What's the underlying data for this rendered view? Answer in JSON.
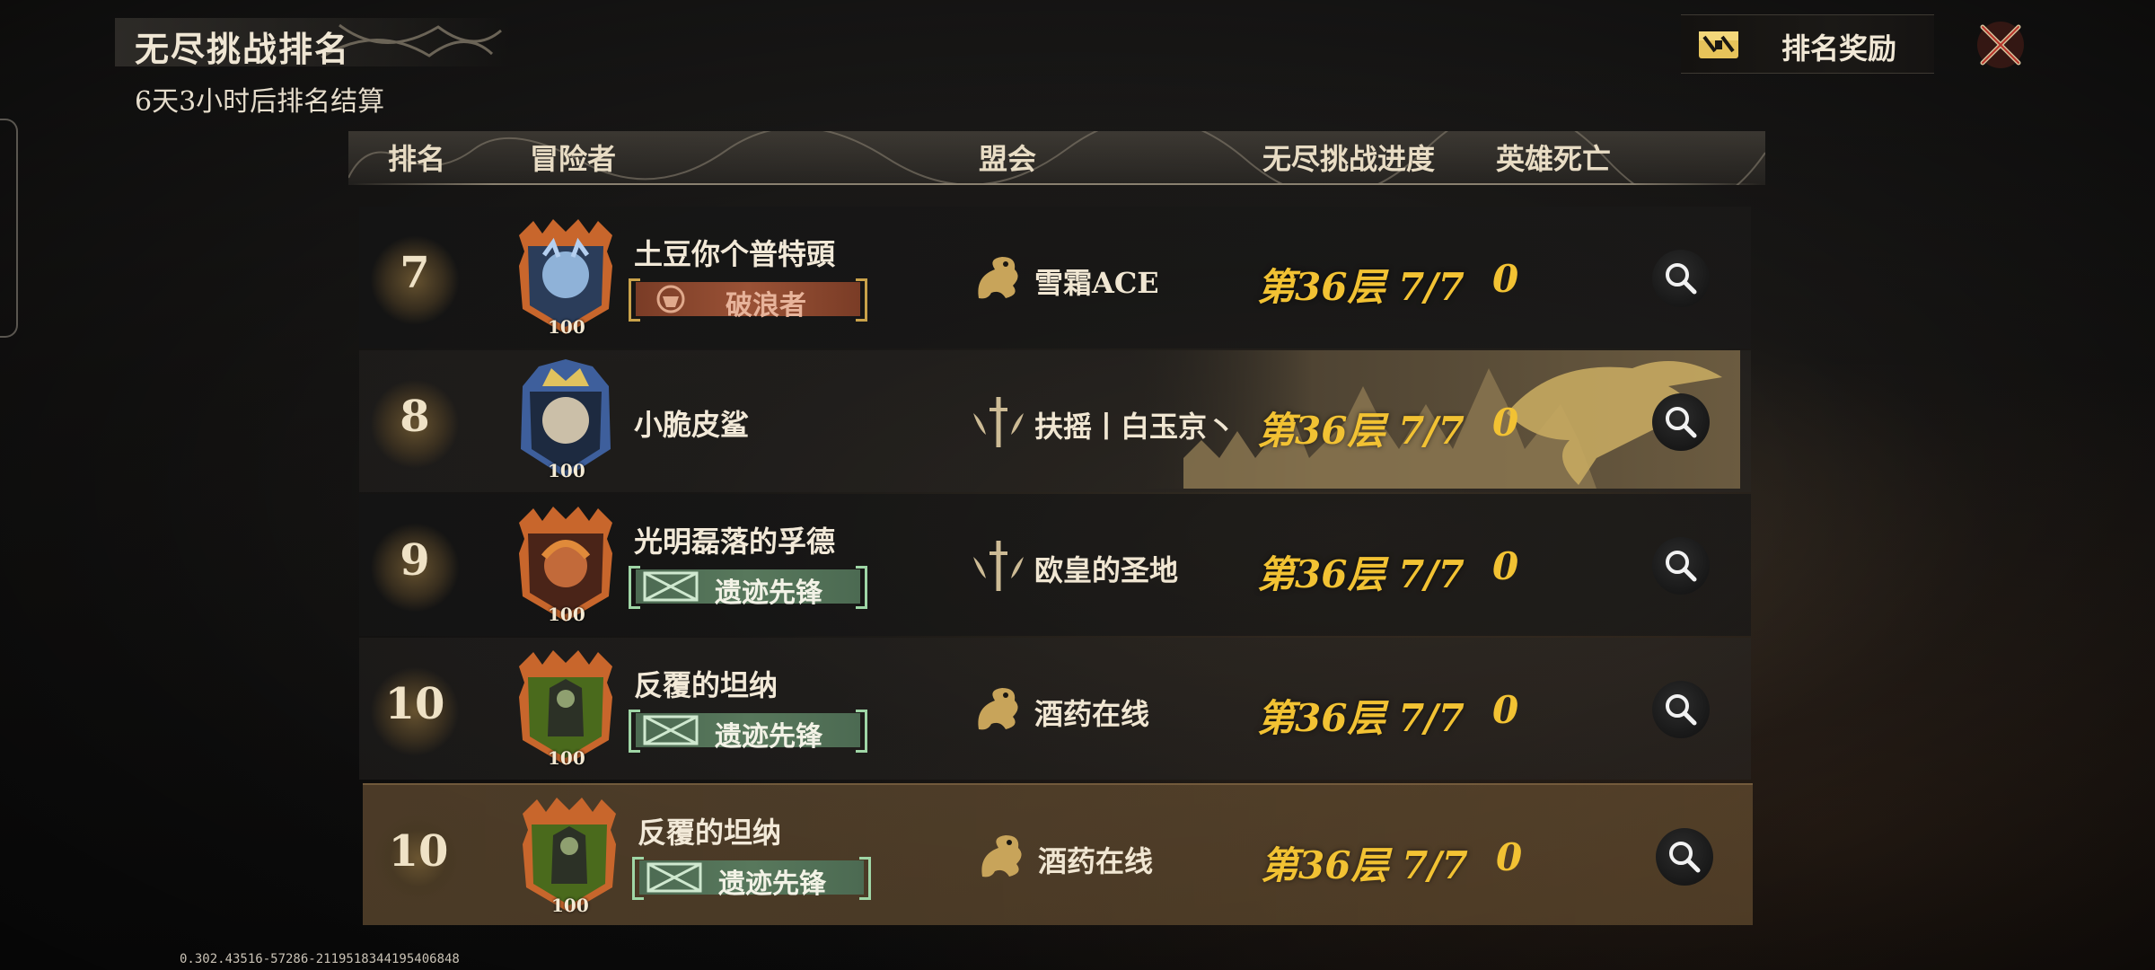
{
  "header": {
    "title": "无尽挑战排名",
    "countdown": "6天3小时后排名结算",
    "reward_button": "排名奖励",
    "reward_icon": "treasure-chest-icon",
    "close_icon": "close-x-icon"
  },
  "columns": {
    "rank": "排名",
    "adventurer": "冒险者",
    "guild": "盟会",
    "progress": "无尽挑战进度",
    "deaths": "英雄死亡"
  },
  "rows": [
    {
      "rank": "7",
      "name": "土豆你个普特頭",
      "level": "100",
      "badge": "破浪者",
      "badge_style": "red",
      "guild_icon": "dragon-emblem-icon",
      "guild": "雪霜ACE",
      "progress": "第36层 7/7",
      "deaths": "0"
    },
    {
      "rank": "8",
      "name": "小脆皮鲨",
      "level": "100",
      "badge": "",
      "guild_icon": "sword-wings-emblem-icon",
      "guild": "扶摇丨白玉京丶",
      "progress": "第36层 7/7",
      "deaths": "0"
    },
    {
      "rank": "9",
      "name": "光明磊落的孚德",
      "level": "100",
      "badge": "遗迹先锋",
      "badge_style": "green",
      "guild_icon": "sword-wings-emblem-icon",
      "guild": "欧皇的圣地",
      "progress": "第36层 7/7",
      "deaths": "0"
    },
    {
      "rank": "10",
      "name": "反覆的坦纳",
      "level": "100",
      "badge": "遗迹先锋",
      "badge_style": "green",
      "guild_icon": "dragon-emblem-icon",
      "guild": "酒药在线",
      "progress": "第36层 7/7",
      "deaths": "0"
    }
  ],
  "self_row": {
    "rank": "10",
    "name": "反覆的坦纳",
    "level": "100",
    "badge": "遗迹先锋",
    "badge_style": "green",
    "guild_icon": "dragon-emblem-icon",
    "guild": "酒药在线",
    "progress": "第36层 7/7",
    "deaths": "0"
  },
  "version": "0.302.43516-57286-2119518344195406848",
  "colors": {
    "accent": "#f2c233",
    "text": "#e8dcc4",
    "self_row": "#7a5c38"
  }
}
